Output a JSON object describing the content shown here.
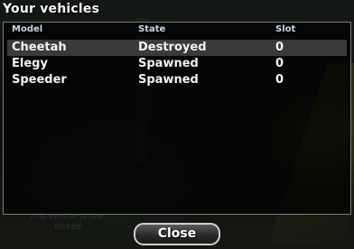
{
  "dialog": {
    "title": "Your vehicles"
  },
  "table": {
    "columns": [
      "Model",
      "State",
      "Slot"
    ],
    "rows": [
      {
        "model": "Cheetah",
        "state": "Destroyed",
        "slot": "0"
      },
      {
        "model": "Elegy",
        "state": "Spawned",
        "slot": "0"
      },
      {
        "model": "Speeder",
        "state": "Spawned",
        "slot": "0"
      }
    ],
    "selected_row": 0
  },
  "buttons": {
    "close_label": "Close"
  },
  "background": {
    "hint_text": "This vehicle is tire-locked"
  },
  "colors": {
    "header_text": "#c8d6e8",
    "row_text": "#f2f2f2",
    "selected_row_bg": "#3a3a3a"
  }
}
